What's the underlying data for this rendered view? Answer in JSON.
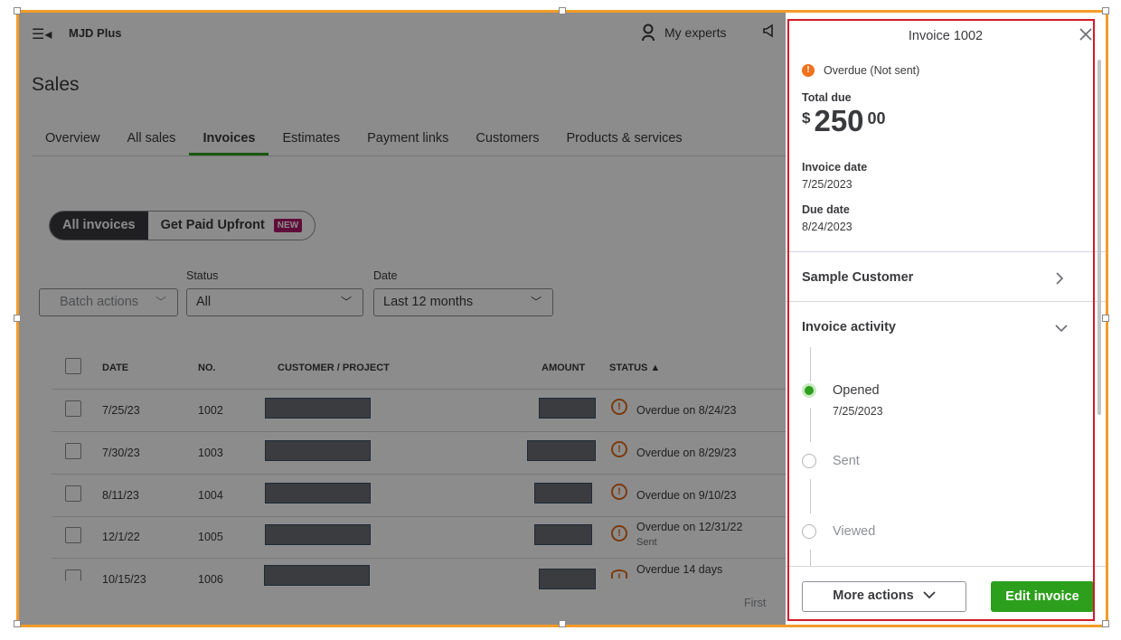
{
  "topbar": {
    "company_name": "MJD Plus",
    "my_experts_label": "My experts"
  },
  "page": {
    "title": "Sales"
  },
  "tabs": [
    {
      "label": "Overview",
      "active": false
    },
    {
      "label": "All sales",
      "active": false
    },
    {
      "label": "Invoices",
      "active": true
    },
    {
      "label": "Estimates",
      "active": false
    },
    {
      "label": "Payment links",
      "active": false
    },
    {
      "label": "Customers",
      "active": false
    },
    {
      "label": "Products & services",
      "active": false
    }
  ],
  "segmented": {
    "all_invoices": "All invoices",
    "get_paid_upfront": "Get Paid Upfront",
    "new_badge": "NEW"
  },
  "filters": {
    "batch_actions": "Batch actions",
    "status_label": "Status",
    "status_value": "All",
    "date_label": "Date",
    "date_value": "Last 12 months"
  },
  "table": {
    "headers": {
      "date": "DATE",
      "no": "NO.",
      "customer": "CUSTOMER / PROJECT",
      "amount": "AMOUNT",
      "status": "STATUS ▲"
    },
    "rows": [
      {
        "date": "7/25/23",
        "no": "1002",
        "status": "Overdue on 8/24/23",
        "status_sub": ""
      },
      {
        "date": "7/30/23",
        "no": "1003",
        "status": "Overdue on 8/29/23",
        "status_sub": ""
      },
      {
        "date": "8/11/23",
        "no": "1004",
        "status": "Overdue on 9/10/23",
        "status_sub": ""
      },
      {
        "date": "12/1/22",
        "no": "1005",
        "status": "Overdue on 12/31/22",
        "status_sub": "Sent"
      },
      {
        "date": "10/15/23",
        "no": "1006",
        "status": "Overdue 14 days",
        "status_sub": ""
      }
    ],
    "pagination_first": "First"
  },
  "panel": {
    "title": "Invoice 1002",
    "overdue_status": "Overdue (Not sent)",
    "total_due_label": "Total due",
    "currency": "$",
    "amount_whole": "250",
    "amount_cents": "00",
    "invoice_date_label": "Invoice date",
    "invoice_date": "7/25/2023",
    "due_date_label": "Due date",
    "due_date": "8/24/2023",
    "customer_name": "Sample Customer",
    "activity_title": "Invoice activity",
    "activity": [
      {
        "label": "Opened",
        "date": "7/25/2023",
        "done": true
      },
      {
        "label": "Sent",
        "date": "",
        "done": false
      },
      {
        "label": "Viewed",
        "date": "",
        "done": false
      }
    ],
    "more_actions": "More actions",
    "edit_invoice": "Edit invoice"
  },
  "colors": {
    "accent_green": "#2ca01c",
    "overdue_orange": "#f2711c",
    "frame_orange": "#f39c2a",
    "panel_highlight_red": "#d21b2a",
    "badge_magenta": "#b0166a"
  }
}
